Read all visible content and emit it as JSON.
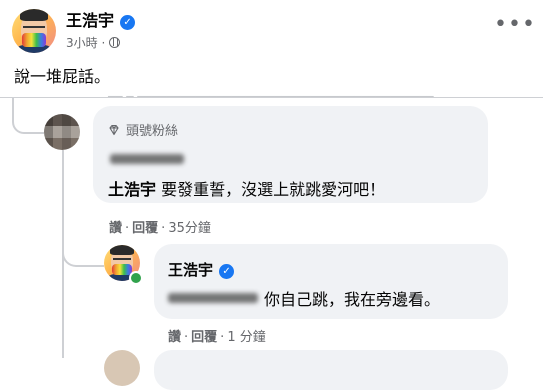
{
  "post": {
    "author": "王浩宇",
    "time": "3小時",
    "text": "說一堆屁話。",
    "more_icon": "more-horizontal-icon",
    "privacy_icon": "globe-icon"
  },
  "comment1": {
    "badge": "頭號粉絲",
    "badge_icon": "diamond-icon",
    "mention": "土浩宇",
    "text": "要發重誓，沒選上就跳愛河吧！",
    "like": "讚",
    "reply": "回覆",
    "time": "35分鐘"
  },
  "comment2": {
    "author": "王浩宇",
    "text": "你自己跳，我在旁邊看。",
    "like": "讚",
    "reply": "回覆",
    "time": "1 分鐘"
  },
  "colors": {
    "verified": "#1877f2",
    "bubble": "#f0f2f5",
    "secondary_text": "#65676b",
    "online": "#31a24c"
  }
}
